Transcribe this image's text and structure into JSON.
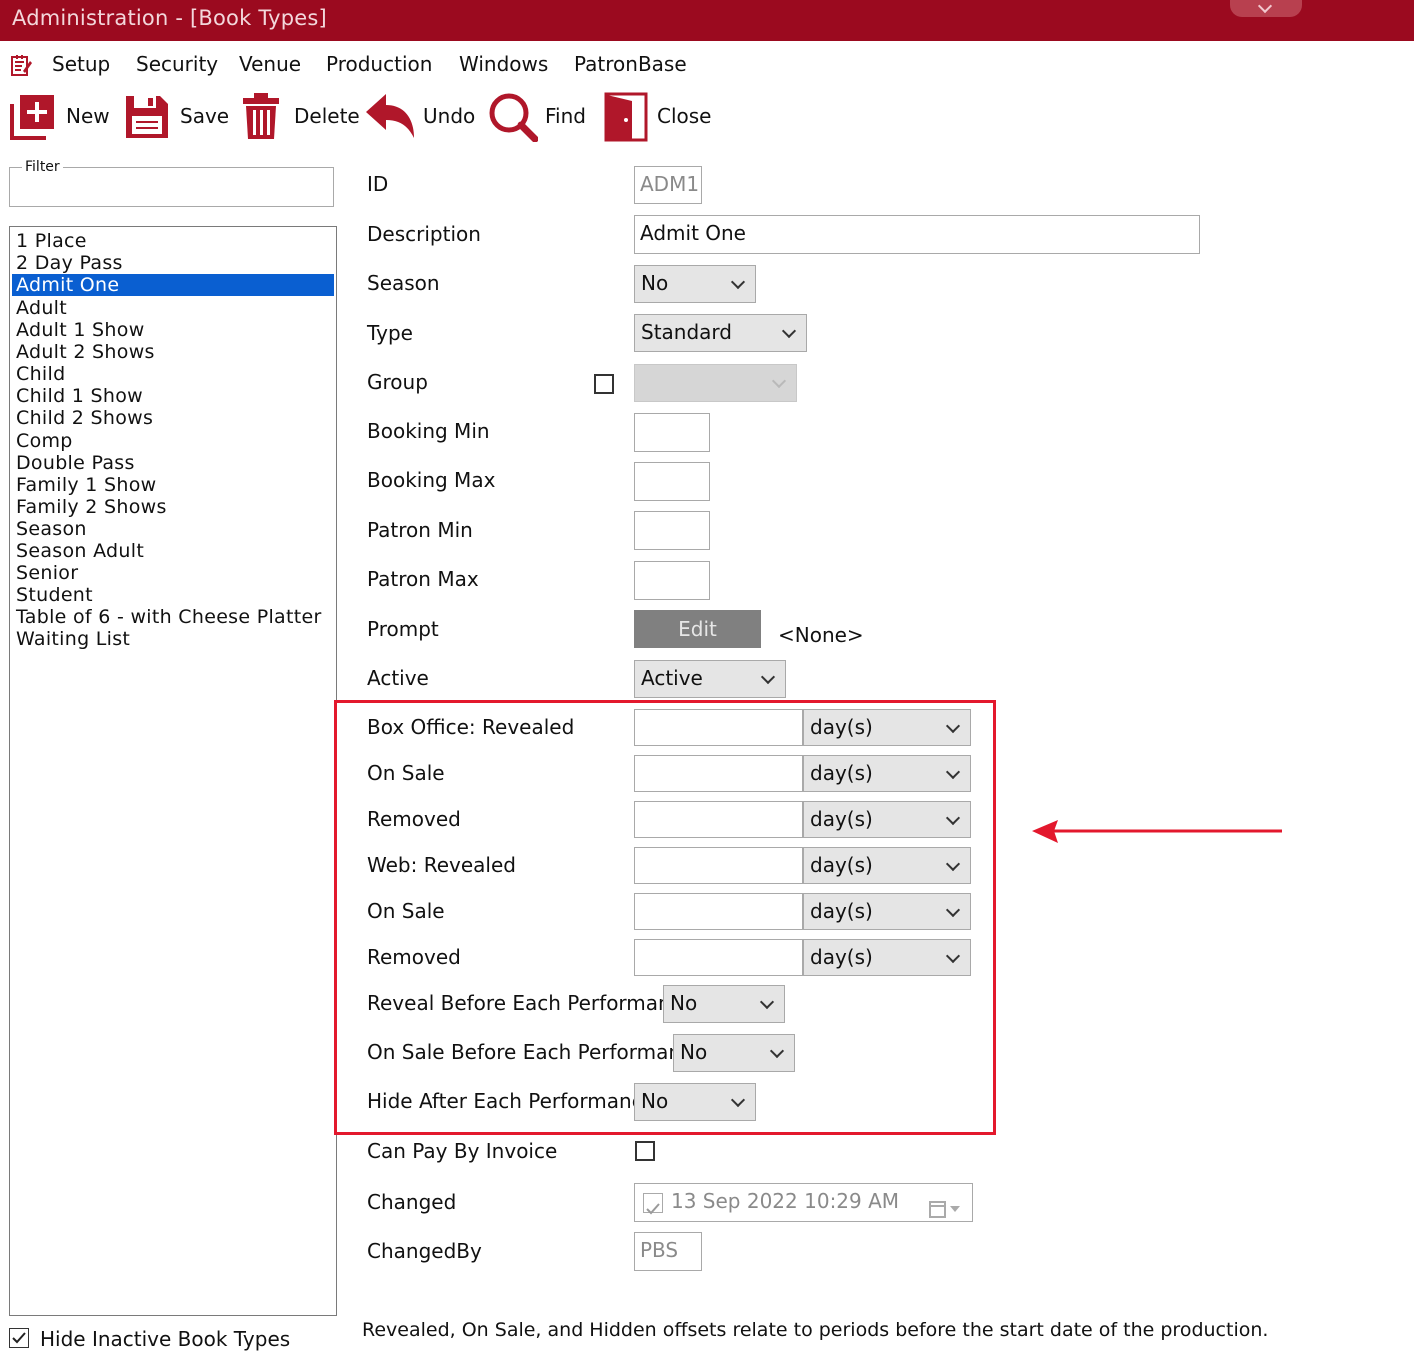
{
  "window": {
    "title": "Administration - [Book Types]"
  },
  "menu": [
    "Setup",
    "Security",
    "Venue",
    "Production",
    "Windows",
    "PatronBase"
  ],
  "toolbar": {
    "new": "New",
    "save": "Save",
    "delete": "Delete",
    "undo": "Undo",
    "find": "Find",
    "close": "Close"
  },
  "filter": {
    "label": "Filter",
    "value": ""
  },
  "list": {
    "items": [
      "1 Place",
      "2 Day Pass",
      "Admit One",
      "Adult",
      "Adult 1 Show",
      "Adult 2 Shows",
      "Child",
      "Child 1 Show",
      "Child 2 Shows",
      "Comp",
      "Double Pass",
      "Family 1 Show",
      "Family 2 Shows",
      "Season",
      "Season Adult",
      "Senior",
      "Student",
      "Table of 6 - with Cheese Platter",
      "Waiting List"
    ],
    "selected_index": 2,
    "hide_inactive_label": "Hide Inactive Book Types",
    "hide_inactive_checked": true
  },
  "form": {
    "id": {
      "label": "ID",
      "value": "ADM1"
    },
    "description": {
      "label": "Description",
      "value": "Admit One"
    },
    "season": {
      "label": "Season",
      "value": "No"
    },
    "type": {
      "label": "Type",
      "value": "Standard"
    },
    "group": {
      "label": "Group",
      "checked": false,
      "value": ""
    },
    "booking_min": {
      "label": "Booking Min",
      "value": ""
    },
    "booking_max": {
      "label": "Booking Max",
      "value": ""
    },
    "patron_min": {
      "label": "Patron Min",
      "value": ""
    },
    "patron_max": {
      "label": "Patron Max",
      "value": ""
    },
    "prompt": {
      "label": "Prompt",
      "button": "Edit",
      "value": "<None>"
    },
    "active": {
      "label": "Active",
      "value": "Active"
    },
    "offsets": [
      {
        "label": "Box Office: Revealed",
        "value": "",
        "unit": "day(s)"
      },
      {
        "label": "On Sale",
        "value": "",
        "unit": "day(s)"
      },
      {
        "label": "Removed",
        "value": "",
        "unit": "day(s)"
      },
      {
        "label": "Web: Revealed",
        "value": "",
        "unit": "day(s)"
      },
      {
        "label": "On Sale",
        "value": "",
        "unit": "day(s)"
      },
      {
        "label": "Removed",
        "value": "",
        "unit": "day(s)"
      }
    ],
    "reveal_before": {
      "label": "Reveal Before Each Performance",
      "value": "No"
    },
    "onsale_before": {
      "label": "On Sale Before Each Performance",
      "value": "No"
    },
    "hide_after": {
      "label": "Hide After Each Performance",
      "value": "No"
    },
    "can_pay_invoice": {
      "label": "Can Pay By Invoice",
      "checked": false
    },
    "changed": {
      "label": "Changed",
      "value": "13  Sep  2022 10:29 AM"
    },
    "changed_by": {
      "label": "ChangedBy",
      "value": "PBS"
    }
  },
  "footer_note": "Revealed, On Sale, and Hidden offsets relate to periods before the start date of the production.",
  "colors": {
    "titlebar": "#9b0a1f",
    "selection": "#0a5fd1",
    "highlight_box": "#e3182d",
    "edit_button": "#808080"
  }
}
